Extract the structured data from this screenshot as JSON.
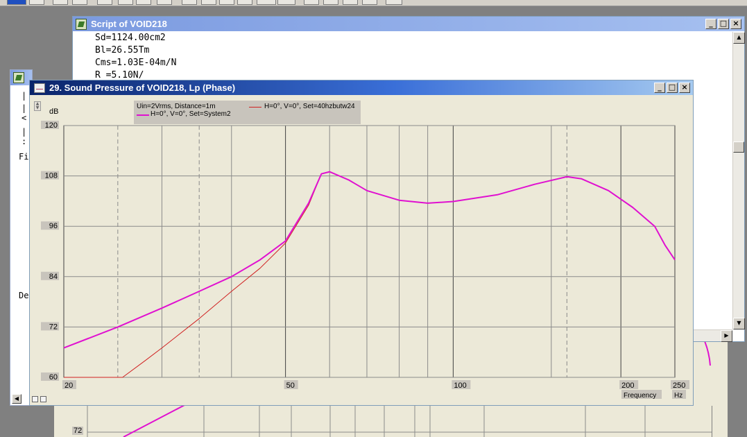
{
  "script_window": {
    "title": "Script of VOID218",
    "lines": [
      "Sd=1124.00cm2",
      "Bl=26.55Tm",
      "Cms=1.03E-04m/N",
      "R  =5.10N/"
    ]
  },
  "side_window": {
    "fragments": [
      "|",
      "| <",
      "| :",
      "Fi",
      "De"
    ]
  },
  "chart_window": {
    "title": "29. Sound Pressure of VOID218, Lp (Phase)",
    "controls": {
      "minimize": "_",
      "maximize": "□",
      "close": "×"
    }
  },
  "colors": {
    "series_system2": "#e010d0",
    "series_butterworth": "#d02020",
    "plot_bg": "#ece9d8",
    "grid": "#8a8a8a"
  },
  "chart_data": {
    "type": "line",
    "xscale": "log",
    "xlim": [
      20,
      250
    ],
    "ylim": [
      60,
      120
    ],
    "xticks": [
      "20",
      "50",
      "100",
      "200",
      "250"
    ],
    "yticks": [
      "60",
      "72",
      "84",
      "96",
      "108",
      "120"
    ],
    "ylabel": "dB",
    "xlabel": "Frequency",
    "xunit": "Hz",
    "legend_header": "Uin=2Vrms, Distance=1m",
    "series": [
      {
        "name": "H=0°, V=0°, Set=40hzbutw24",
        "color": "#d02020",
        "width": 1,
        "points": [
          [
            20,
            60
          ],
          [
            25.5,
            60
          ],
          [
            28,
            64
          ],
          [
            30,
            67
          ],
          [
            35,
            74
          ],
          [
            40,
            80.5
          ],
          [
            45,
            86
          ],
          [
            50,
            92
          ],
          [
            55,
            101
          ],
          [
            58,
            108.5
          ],
          [
            60,
            109
          ],
          [
            65,
            107
          ],
          [
            70,
            104.5
          ],
          [
            80,
            102.2
          ],
          [
            90,
            101.5
          ],
          [
            100,
            101.9
          ],
          [
            120,
            103.5
          ],
          [
            140,
            106
          ],
          [
            160,
            107.8
          ],
          [
            170,
            107.3
          ],
          [
            190,
            104.5
          ],
          [
            210,
            100.5
          ],
          [
            230,
            96
          ],
          [
            240,
            91.5
          ],
          [
            250,
            88
          ]
        ]
      },
      {
        "name": "H=0°, V=0°, Set=System2",
        "color": "#e010d0",
        "width": 2,
        "points": [
          [
            20,
            67
          ],
          [
            25,
            72
          ],
          [
            30,
            76.5
          ],
          [
            35,
            80.5
          ],
          [
            40,
            84
          ],
          [
            45,
            88
          ],
          [
            50,
            92.5
          ],
          [
            55,
            101.5
          ],
          [
            58,
            108.5
          ],
          [
            60,
            109
          ],
          [
            65,
            107
          ],
          [
            70,
            104.5
          ],
          [
            80,
            102.2
          ],
          [
            90,
            101.5
          ],
          [
            100,
            101.9
          ],
          [
            120,
            103.5
          ],
          [
            140,
            106
          ],
          [
            160,
            107.8
          ],
          [
            170,
            107.3
          ],
          [
            190,
            104.5
          ],
          [
            210,
            100.5
          ],
          [
            230,
            96
          ],
          [
            240,
            91.5
          ],
          [
            250,
            88
          ]
        ]
      }
    ]
  },
  "back_plot": {
    "y_label": "72"
  }
}
